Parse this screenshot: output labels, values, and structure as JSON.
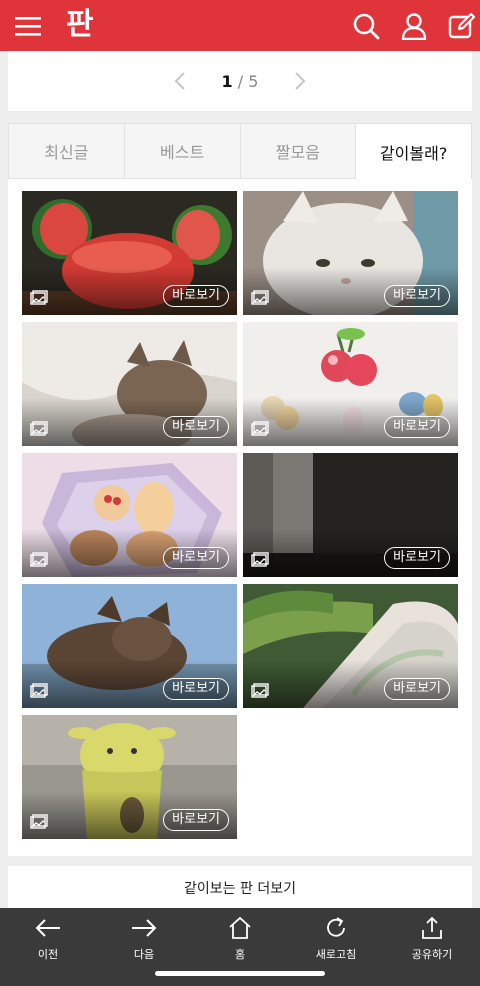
{
  "header": {
    "brand": "판",
    "accent": "#e0343b",
    "icons": [
      "menu-icon",
      "search-icon",
      "user-icon",
      "edit-icon"
    ]
  },
  "pagination": {
    "current": "1",
    "separator": "/",
    "total": "5"
  },
  "tabs": [
    {
      "label": "최신글",
      "active": false
    },
    {
      "label": "베스트",
      "active": false
    },
    {
      "label": "짤모음",
      "active": false
    },
    {
      "label": "같이볼래?",
      "active": true
    }
  ],
  "gallery": {
    "view_label": "바로보기",
    "items": [
      {
        "subject": "watermelon"
      },
      {
        "subject": "white-cat"
      },
      {
        "subject": "kitten"
      },
      {
        "subject": "cherry-accessories"
      },
      {
        "subject": "cookies"
      },
      {
        "subject": "dark-room"
      },
      {
        "subject": "kitten-blue-bg"
      },
      {
        "subject": "roll-cake"
      },
      {
        "subject": "yellow-character"
      }
    ]
  },
  "more": {
    "label": "같이보는 판 더보기"
  },
  "bottom_nav": [
    {
      "label": "이전",
      "icon": "arrow-left-icon"
    },
    {
      "label": "다음",
      "icon": "arrow-right-icon"
    },
    {
      "label": "홈",
      "icon": "home-icon"
    },
    {
      "label": "새로고침",
      "icon": "refresh-icon"
    },
    {
      "label": "공유하기",
      "icon": "share-icon"
    }
  ]
}
